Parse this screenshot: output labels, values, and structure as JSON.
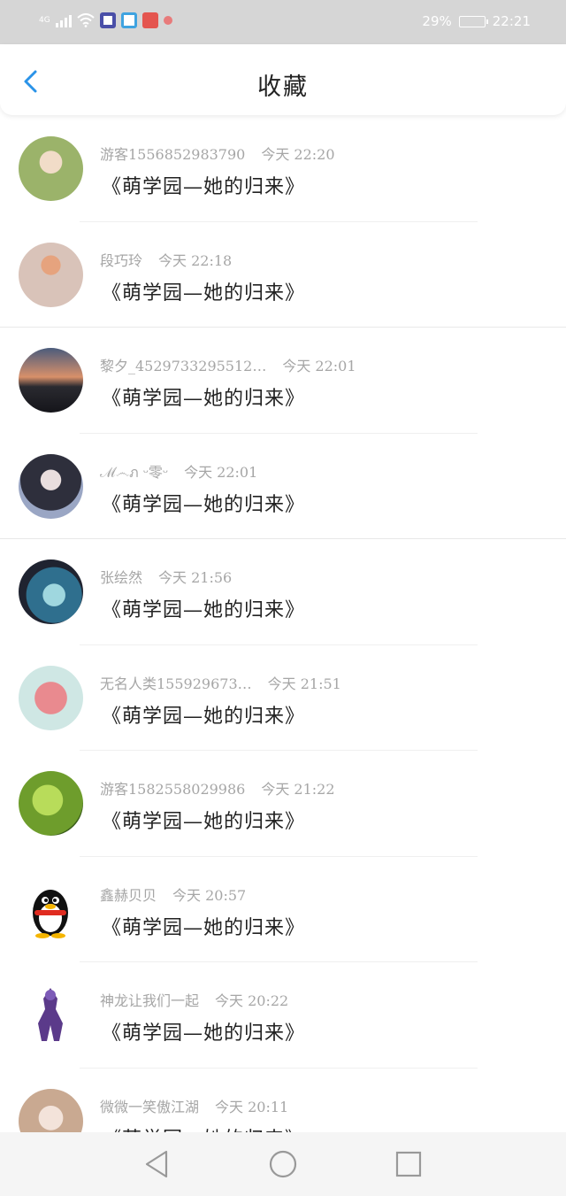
{
  "status_bar": {
    "network": "4G",
    "battery": "29%",
    "time": "22:21"
  },
  "header": {
    "title": "收藏"
  },
  "colors": {
    "accent": "#2a93e8",
    "status_bar_bg": "#d6d6d6",
    "meta_text": "#a6a6a6"
  },
  "icons": {
    "back": "chevron-left-icon",
    "nav_back": "triangle-back-icon",
    "nav_home": "circle-home-icon",
    "nav_recent": "square-recent-icon"
  },
  "items": [
    {
      "name": "游客1556852983790",
      "time": "今天  22:20",
      "subject": "《萌学园—她的归来》",
      "avatar": "#9bb36a"
    },
    {
      "name": "段巧玲",
      "time": "今天  22:18",
      "subject": "《萌学园—她的归来》",
      "avatar": "#d7a88f"
    },
    {
      "name": "黎夕_4529733295512…",
      "time": "今天  22:01",
      "subject": "《萌学园—她的归来》",
      "avatar": "#3b3f52"
    },
    {
      "name": "ℳ෴ภ ᵕ零ᵕ",
      "time": "今天  22:01",
      "subject": "《萌学园—她的归来》",
      "avatar": "#2e2f3c"
    },
    {
      "name": "张绘然",
      "time": "今天  21:56",
      "subject": "《萌学园—她的归来》",
      "avatar": "#2f6f8e"
    },
    {
      "name": "无名人类155929673…",
      "time": "今天  21:51",
      "subject": "《萌学园—她的归来》",
      "avatar": "#e98a8f"
    },
    {
      "name": "游客1582558029986",
      "time": "今天  21:22",
      "subject": "《萌学园—她的归来》",
      "avatar": "#6e9d2c"
    },
    {
      "name": "鑫赫贝贝",
      "time": "今天  20:57",
      "subject": "《萌学园—她的归来》",
      "avatar": "qq-penguin"
    },
    {
      "name": "神龙让我们一起",
      "time": "今天  20:22",
      "subject": "《萌学园—她的归来》",
      "avatar": "#5b3a8a"
    },
    {
      "name": "微微一笑傲江湖",
      "time": "今天  20:11",
      "subject": "《萌学园—她的归来》",
      "avatar": "#c9a991"
    }
  ]
}
